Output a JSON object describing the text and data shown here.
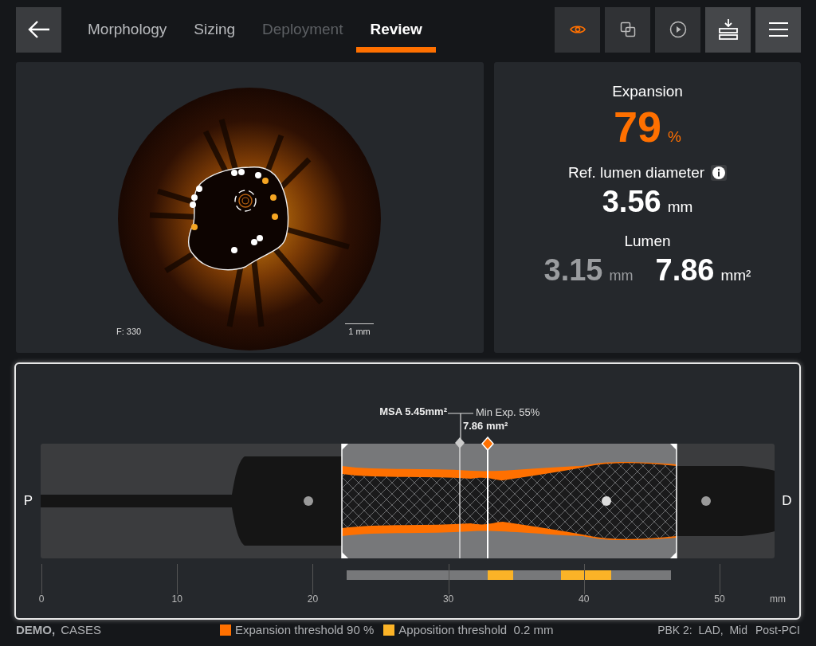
{
  "nav": {
    "tabs": [
      {
        "label": "Morphology",
        "selected": false,
        "disabled": false
      },
      {
        "label": "Sizing",
        "selected": false,
        "disabled": false
      },
      {
        "label": "Deployment",
        "selected": false,
        "disabled": true
      },
      {
        "label": "Review",
        "selected": true,
        "disabled": false
      }
    ],
    "tools": [
      {
        "kind": "eye",
        "active": true
      },
      {
        "kind": "layers",
        "active": false
      },
      {
        "kind": "play",
        "active": false
      },
      {
        "kind": "download",
        "active": false
      },
      {
        "kind": "menu",
        "active": false
      }
    ]
  },
  "image_panel": {
    "frame": "F: 330",
    "scale": "1 mm"
  },
  "metrics": {
    "expansion": {
      "label": "Expansion",
      "value": "79",
      "unit": "%"
    },
    "reference": {
      "label": "Ref. lumen diameter",
      "value": "3.56",
      "unit": "mm"
    },
    "lumen": {
      "label": "Lumen",
      "diameter": {
        "value": "3.15",
        "unit": "mm"
      },
      "area": {
        "value": "7.86",
        "unit": "mm²"
      }
    }
  },
  "profile": {
    "msa": "MSA 5.45mm²",
    "min_expansion": "Min Exp. 55%",
    "area": "7.86 mm²",
    "proximal": "P",
    "distal": "D",
    "ticks": [
      "0",
      "10",
      "20",
      "30",
      "40",
      "50"
    ],
    "unit": "mm"
  },
  "footer": {
    "site": "DEMO,",
    "cases": "CASES",
    "legend": [
      {
        "label": "Expansion threshold 90 %",
        "color": "#ff7000"
      },
      {
        "label": "Apposition threshold  0.2 mm",
        "color": "#fbb327"
      }
    ],
    "vessel": "PBK 2:  LAD,  Mid",
    "stage": "Post-PCI"
  }
}
